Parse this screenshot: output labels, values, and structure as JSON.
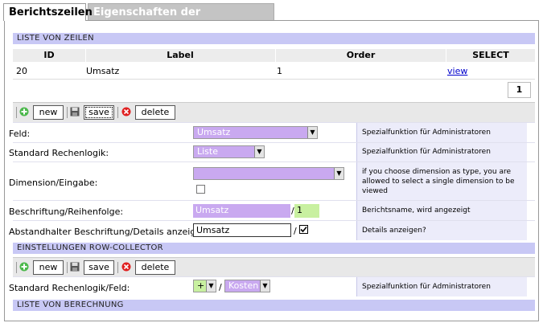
{
  "tabs": [
    "Berichtszeilen",
    "Eigenschaften der Berichtsspalte"
  ],
  "sections": {
    "rows": "LISTE VON ZEILEN",
    "collector": "EINSTELLUNGEN ROW-COLLECTOR",
    "calc": "LISTE VON BERECHNUNG"
  },
  "table": {
    "headers": [
      "ID",
      "Label",
      "Order",
      "SELECT"
    ],
    "rows": [
      {
        "id": "20",
        "label": "Umsatz",
        "order": "1",
        "select": "view"
      }
    ]
  },
  "pagination": {
    "page": "1"
  },
  "toolbar": {
    "new": "new",
    "save": "save",
    "delete": "delete"
  },
  "fields": {
    "feld": {
      "label": "Feld:",
      "value": "Umsatz",
      "help": "Spezialfunktion für Administratoren"
    },
    "rechenlogik": {
      "label": "Standard Rechenlogik:",
      "value": "Liste",
      "help": "Spezialfunktion für Administratoren"
    },
    "dimension": {
      "label": "Dimension/Eingabe:",
      "value": "",
      "help": "if you choose dimension as type, you are allowed to select a single dimension to be viewed"
    },
    "beschriftung": {
      "label": "Beschriftung/Reihenfolge:",
      "value": "Umsatz",
      "order": "1",
      "help": "Berichtsname, wird angezeigt"
    },
    "abstand": {
      "label": "Abstandhalter Beschriftung/Details anzeigen:",
      "value": "Umsatz",
      "help": "Details anzeigen?"
    }
  },
  "collector": {
    "label": "Standard Rechenlogik/Feld:",
    "op": "+",
    "field": "Kosten",
    "help": "Spezialfunktion für Administratoren"
  },
  "colors": {
    "band": "#c8c8f5",
    "select_bg": "#c9a9f0",
    "help_bg": "#ececfa",
    "green_input": "#c8f0a0"
  },
  "icons": [
    "plus-icon",
    "floppy-disk-icon",
    "delete-x-icon",
    "checkbox-checked-icon",
    "dropdown-arrow-icon"
  ]
}
